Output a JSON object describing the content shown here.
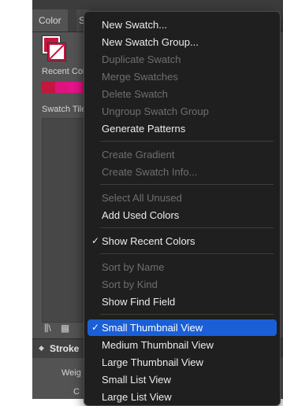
{
  "panel": {
    "tabs": [
      {
        "label": "Color"
      },
      {
        "label": "S"
      }
    ],
    "recent_colors_label": "Recent Col",
    "swatch_tile_label": "Swatch Tile",
    "recent_colors": [
      "#c4163e",
      "#e0127e",
      "#e8118a",
      "#d40f6e",
      "#1a1a1a"
    ],
    "stroke": {
      "label": "Stroke",
      "weight_label": "Weig",
      "cap_label": "C"
    }
  },
  "menu": {
    "items": [
      {
        "label": "New Swatch...",
        "enabled": true
      },
      {
        "label": "New Swatch Group...",
        "enabled": true
      },
      {
        "label": "Duplicate Swatch",
        "enabled": false
      },
      {
        "label": "Merge Swatches",
        "enabled": false
      },
      {
        "label": "Delete Swatch",
        "enabled": false
      },
      {
        "label": "Ungroup Swatch Group",
        "enabled": false
      },
      {
        "label": "Generate Patterns",
        "enabled": true
      },
      {
        "label": "Create Gradient",
        "enabled": false
      },
      {
        "label": "Create Swatch Info...",
        "enabled": false
      },
      {
        "label": "Select All Unused",
        "enabled": false
      },
      {
        "label": "Add Used Colors",
        "enabled": true
      },
      {
        "label": "Show Recent Colors",
        "enabled": true,
        "checked": true
      },
      {
        "label": "Sort by Name",
        "enabled": false
      },
      {
        "label": "Sort by Kind",
        "enabled": false
      },
      {
        "label": "Show Find Field",
        "enabled": true
      },
      {
        "label": "Small Thumbnail View",
        "enabled": true,
        "checked": true,
        "highlighted": true
      },
      {
        "label": "Medium Thumbnail View",
        "enabled": true
      },
      {
        "label": "Large Thumbnail View",
        "enabled": true
      },
      {
        "label": "Small List View",
        "enabled": true
      },
      {
        "label": "Large List View",
        "enabled": true
      }
    ],
    "check_mark": "✓"
  },
  "colors": {
    "accent": "#1a5fd6",
    "fill": "#c4163e"
  }
}
